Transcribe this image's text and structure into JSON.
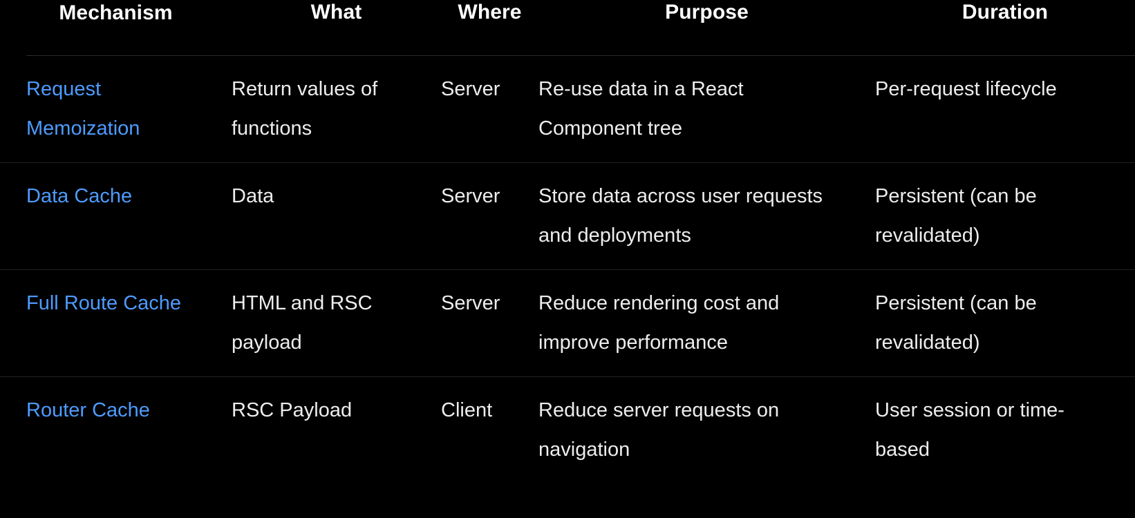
{
  "table": {
    "columns": [
      {
        "key": "mechanism",
        "label": "Mechanism"
      },
      {
        "key": "what",
        "label": "What"
      },
      {
        "key": "where",
        "label": "Where"
      },
      {
        "key": "purpose",
        "label": "Purpose"
      },
      {
        "key": "duration",
        "label": "Duration"
      }
    ],
    "rows": [
      {
        "mechanism": "Request Memoization",
        "mechanism_is_link": true,
        "what": "Return values of functions",
        "where": "Server",
        "purpose": "Re-use data in a React Component tree",
        "duration": "Per-request lifecycle"
      },
      {
        "mechanism": "Data Cache",
        "mechanism_is_link": true,
        "what": "Data",
        "where": "Server",
        "purpose": "Store data across user requests and deployments",
        "duration": "Persistent (can be revalidated)"
      },
      {
        "mechanism": "Full Route Cache",
        "mechanism_is_link": true,
        "what": "HTML and RSC payload",
        "where": "Server",
        "purpose": "Reduce rendering cost and improve performance",
        "duration": "Persistent (can be revalidated)"
      },
      {
        "mechanism": "Router Cache",
        "mechanism_is_link": true,
        "what": "RSC Payload",
        "where": "Client",
        "purpose": "Reduce server requests on navigation",
        "duration": "User session or time-based"
      }
    ]
  },
  "colors": {
    "background": "#000000",
    "text": "#ededed",
    "header_text": "#ffffff",
    "link": "#4d9bff",
    "divider": "#222222"
  }
}
